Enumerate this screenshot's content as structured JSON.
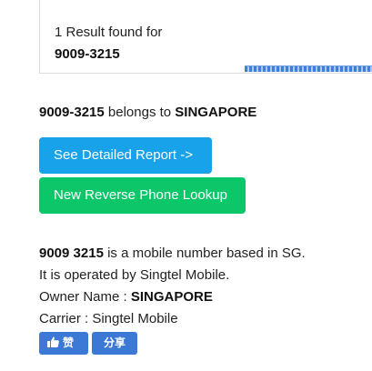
{
  "result_box": {
    "found_text": "1 Result found for",
    "number": "9009-3215"
  },
  "belongs": {
    "number": "9009-3215",
    "middle_text": " belongs to ",
    "country": "SINGAPORE"
  },
  "buttons": {
    "report_label": "See Detailed Report ->",
    "lookup_label": "New Reverse Phone Lookup"
  },
  "info": {
    "number_spaced": "9009 3215",
    "mobile_text": " is a mobile number based in SG.",
    "operated_text": "It is operated by Singtel Mobile.",
    "owner_label": "Owner Name : ",
    "owner_value": "SINGAPORE",
    "carrier_text": "Carrier : Singtel Mobile"
  },
  "social": {
    "like_icon": "thumbs-up-icon",
    "like_label": "赞",
    "share_label": "分享"
  },
  "colors": {
    "report_button": "#17a2e9",
    "lookup_button": "#0bc76a",
    "social_button": "#3c79d6"
  }
}
